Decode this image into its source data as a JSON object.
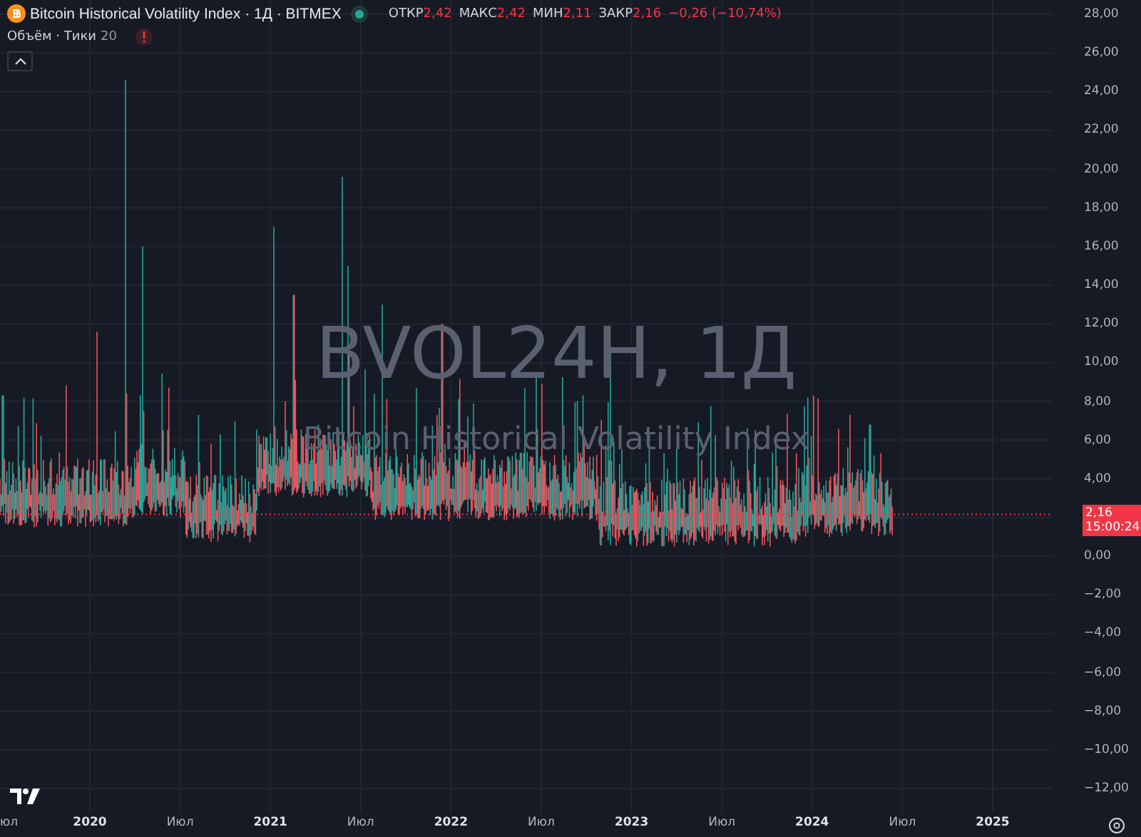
{
  "legend": {
    "title": "Bitcoin Historical Volatility Index · 1Д · BITMEX",
    "market_open": true,
    "ohlc": [
      {
        "label": "ОТКР",
        "value": "2,42"
      },
      {
        "label": "МАКС",
        "value": "2,42"
      },
      {
        "label": "МИН",
        "value": "2,11"
      },
      {
        "label": "ЗАКР",
        "value": "2,16"
      }
    ],
    "change": "−0,26 (−10,74%)"
  },
  "indicator": {
    "name": "Объём · Тики",
    "value": "20"
  },
  "watermark": {
    "title": "BVOL24H, 1Д",
    "subtitle": "Bitcoin Historical Volatility Index"
  },
  "price_axis": [
    "28,00",
    "26,00",
    "24,00",
    "22,00",
    "20,00",
    "18,00",
    "16,00",
    "14,00",
    "12,00",
    "10,00",
    "8,00",
    "6,00",
    "4,00",
    "0,00",
    "−2,00",
    "−4,00",
    "−6,00",
    "−8,00",
    "−10,00",
    "−12,00"
  ],
  "last_price": {
    "value": "2,16",
    "countdown": "15:00:24"
  },
  "time_axis": [
    "юл",
    "2020",
    "Июл",
    "2021",
    "Июл",
    "2022",
    "Июл",
    "2023",
    "Июл",
    "2024",
    "Июл",
    "2025"
  ]
}
